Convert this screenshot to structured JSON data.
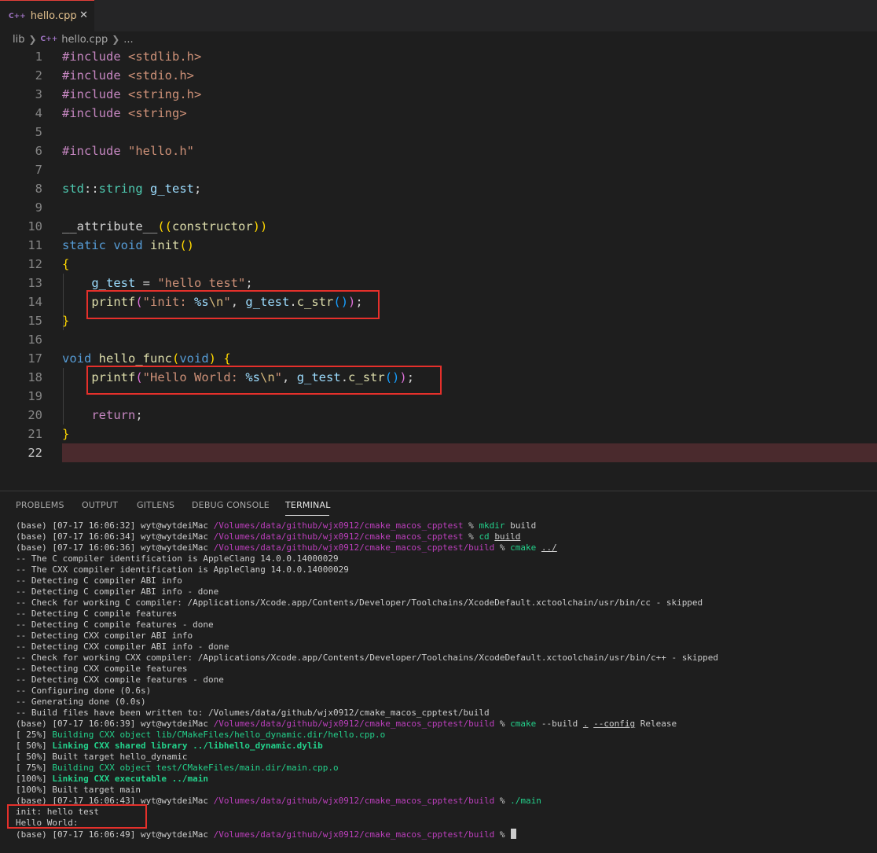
{
  "tab": {
    "icon": "cpp-file-icon",
    "icon_text": "C++",
    "label": "hello.cpp",
    "close": "✕"
  },
  "breadcrumb": {
    "folder": "lib",
    "icon": "cpp-file-icon",
    "icon_text": "C++",
    "file": "hello.cpp",
    "more": "..."
  },
  "editor": {
    "active_line": 22,
    "lines": [
      {
        "n": "1"
      },
      {
        "n": "2"
      },
      {
        "n": "3"
      },
      {
        "n": "4"
      },
      {
        "n": "5"
      },
      {
        "n": "6"
      },
      {
        "n": "7"
      },
      {
        "n": "8"
      },
      {
        "n": "9"
      },
      {
        "n": "10"
      },
      {
        "n": "11"
      },
      {
        "n": "12"
      },
      {
        "n": "13"
      },
      {
        "n": "14"
      },
      {
        "n": "15"
      },
      {
        "n": "16"
      },
      {
        "n": "17"
      },
      {
        "n": "18"
      },
      {
        "n": "19"
      },
      {
        "n": "20"
      },
      {
        "n": "21"
      },
      {
        "n": "22"
      }
    ],
    "tokens": {
      "l1": [
        "#include",
        " ",
        "<stdlib.h>"
      ],
      "l2": [
        "#include",
        " ",
        "<stdio.h>"
      ],
      "l3": [
        "#include",
        " ",
        "<string.h>"
      ],
      "l4": [
        "#include",
        " ",
        "<string>"
      ],
      "l6": [
        "#include",
        " ",
        "\"hello.h\""
      ],
      "l8": [
        "std",
        "::",
        "string",
        " ",
        "g_test",
        ";"
      ],
      "l10": [
        "__attribute__",
        "((",
        "constructor",
        "))"
      ],
      "l11": [
        "static",
        " ",
        "void",
        " ",
        "init",
        "()"
      ],
      "l12": [
        "{"
      ],
      "l13": [
        "    ",
        "g_test",
        " = ",
        "\"hello test\"",
        ";"
      ],
      "l14": [
        "    ",
        "printf",
        "(",
        "\"init: ",
        "%s",
        "\\n",
        "\"",
        ", ",
        "g_test",
        ".",
        "c_str",
        "()",
        ")",
        ";"
      ],
      "l15": [
        "}"
      ],
      "l17": [
        "void",
        " ",
        "hello_func",
        "(",
        "void",
        ")",
        " ",
        "{"
      ],
      "l18": [
        "    ",
        "printf",
        "(",
        "\"Hello World: ",
        "%s",
        "\\n",
        "\"",
        ", ",
        "g_test",
        ".",
        "c_str",
        "()",
        ")",
        ";"
      ],
      "l20": [
        "    ",
        "return",
        ";"
      ],
      "l21": [
        "}"
      ]
    }
  },
  "panel": {
    "tabs": [
      "PROBLEMS",
      "OUTPUT",
      "GITLENS",
      "DEBUG CONSOLE",
      "TERMINAL"
    ],
    "active_tab": "TERMINAL"
  },
  "terminal": {
    "prompts": {
      "p1": {
        "pre": "(base) [07-17 16:06:32] wyt@wytdeiMac ",
        "path": "/Volumes/data/github/wjx0912/cmake_macos_cpptest",
        "pct": " % ",
        "cmd": "mkdir",
        "args": " build"
      },
      "p2": {
        "pre": "(base) [07-17 16:06:34] wyt@wytdeiMac ",
        "path": "/Volumes/data/github/wjx0912/cmake_macos_cpptest",
        "pct": " % ",
        "cmd": "cd",
        "args": "build"
      },
      "p3": {
        "pre": "(base) [07-17 16:06:36] wyt@wytdeiMac ",
        "path": "/Volumes/data/github/wjx0912/cmake_macos_cpptest/build",
        "pct": " % ",
        "cmd": "cmake",
        "args": "../"
      },
      "p4": {
        "pre": "(base) [07-17 16:06:39] wyt@wytdeiMac ",
        "path": "/Volumes/data/github/wjx0912/cmake_macos_cpptest/build",
        "pct": " % ",
        "cmd": "cmake",
        "a1": " --build ",
        "a2": ".",
        "a3": " ",
        "a4": "--config",
        "a5": " Release"
      },
      "p5": {
        "pre": "(base) [07-17 16:06:43] wyt@wytdeiMac ",
        "path": "/Volumes/data/github/wjx0912/cmake_macos_cpptest/build",
        "pct": " % ",
        "cmd": "./main"
      },
      "p6": {
        "pre": "(base) [07-17 16:06:49] wyt@wytdeiMac ",
        "path": "/Volumes/data/github/wjx0912/cmake_macos_cpptest/build",
        "pct": " % "
      }
    },
    "cmake_output": [
      "-- The C compiler identification is AppleClang 14.0.0.14000029",
      "-- The CXX compiler identification is AppleClang 14.0.0.14000029",
      "-- Detecting C compiler ABI info",
      "-- Detecting C compiler ABI info - done",
      "-- Check for working C compiler: /Applications/Xcode.app/Contents/Developer/Toolchains/XcodeDefault.xctoolchain/usr/bin/cc - skipped",
      "-- Detecting C compile features",
      "-- Detecting C compile features - done",
      "-- Detecting CXX compiler ABI info",
      "-- Detecting CXX compiler ABI info - done",
      "-- Check for working CXX compiler: /Applications/Xcode.app/Contents/Developer/Toolchains/XcodeDefault.xctoolchain/usr/bin/c++ - skipped",
      "-- Detecting CXX compile features",
      "-- Detecting CXX compile features - done",
      "-- Configuring done (0.6s)",
      "-- Generating done (0.0s)",
      "-- Build files have been written to: /Volumes/data/github/wjx0912/cmake_macos_cpptest/build"
    ],
    "build_output": [
      {
        "prefix": "[ 25%] ",
        "text": "Building CXX object lib/CMakeFiles/hello_dynamic.dir/hello.cpp.o",
        "style": "green"
      },
      {
        "prefix": "[ 50%] ",
        "text": "Linking CXX shared library ../libhello_dynamic.dylib",
        "style": "bgreen"
      },
      {
        "prefix": "[ 50%] ",
        "text": "Built target hello_dynamic",
        "style": "plain"
      },
      {
        "prefix": "[ 75%] ",
        "text": "Building CXX object test/CMakeFiles/main.dir/main.cpp.o",
        "style": "green"
      },
      {
        "prefix": "[100%] ",
        "text": "Linking CXX executable ../main",
        "style": "bgreen"
      },
      {
        "prefix": "[100%] ",
        "text": "Built target main",
        "style": "plain"
      }
    ],
    "program_output": [
      "init: hello test",
      "Hello World: "
    ]
  }
}
